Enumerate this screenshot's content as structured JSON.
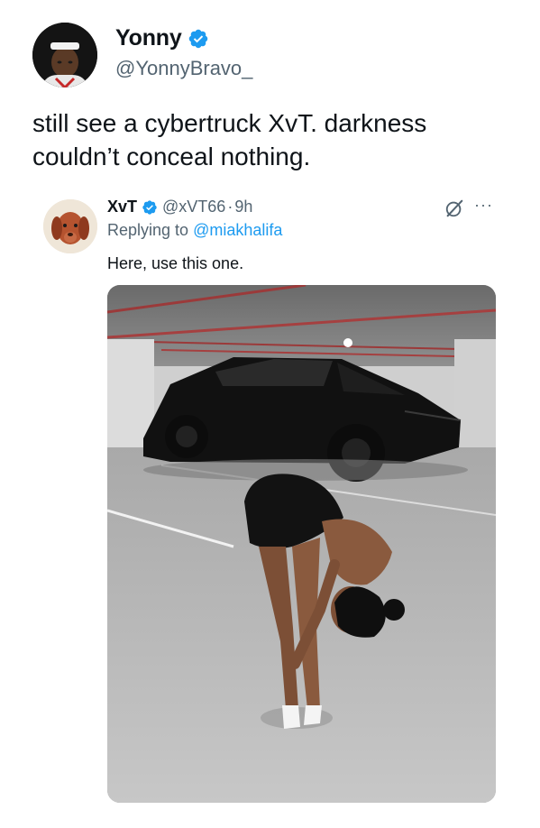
{
  "tweet": {
    "author_name": "Yonny",
    "author_handle": "@YonnyBravo_",
    "text": "still see a cybertruck XvT. darkness couldn’t conceal nothing.",
    "verified": true
  },
  "quoted": {
    "author_name": "XvT",
    "author_handle": "@xVT66",
    "separator": "·",
    "time": "9h",
    "replying_prefix": "Replying to",
    "replying_to": "@miakhalifa",
    "text": "Here, use this one.",
    "verified": true,
    "more_label": "···"
  },
  "icons": {
    "verified": "verified-badge-icon",
    "grok": "grok-icon",
    "more": "more-icon"
  },
  "colors": {
    "verified_blue": "#1d9bf0",
    "secondary_text": "#536471",
    "primary_text": "#0f1419",
    "link": "#1d9bf0"
  }
}
